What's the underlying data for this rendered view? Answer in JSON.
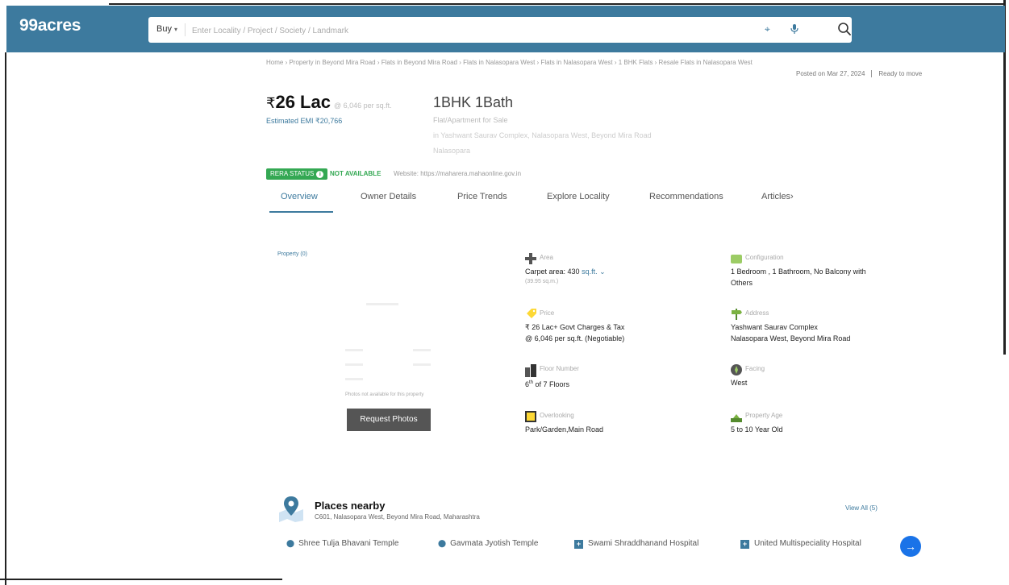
{
  "header": {
    "logo": "99acres",
    "buy_label": "Buy",
    "search_placeholder": "Enter Locality / Project / Society / Landmark"
  },
  "breadcrumb": "Home  ›  Property in Beyond Mira Road  ›  Flats in Beyond Mira Road  ›  Flats in Nalasopara West  ›  Flats in Nalasopara West  ›  1 BHK Flats  ›  Resale Flats in Nalasopara West",
  "posted": {
    "date": "Posted on Mar 27, 2024",
    "status": "Ready to move"
  },
  "listing": {
    "price_symbol": "₹",
    "price": "26 Lac",
    "price_sub": "@ 6,046 per sq.ft.",
    "emi": "Estimated EMI ₹20,766",
    "config": "1BHK 1Bath",
    "type_line": "Flat/Apartment for Sale",
    "address_line": "in Yashwant Saurav Complex, Nalasopara West, Beyond Mira Road",
    "extra_line": "Nalasopara"
  },
  "rera": {
    "badge": "RERA STATUS",
    "status": "NOT AVAILABLE",
    "website": "Website: https://maharera.mahaonline.gov.in"
  },
  "tabs": [
    "Overview",
    "Owner Details",
    "Price Trends",
    "Explore Locality",
    "Recommendations",
    "Articles"
  ],
  "photos": {
    "count": "Property (0)",
    "note": "Photos not available for this property",
    "request_button": "Request Photos"
  },
  "details": {
    "area": {
      "label": "Area",
      "value": "Carpet area: 430",
      "unit": "sq.ft.",
      "sub": "(39.95 sq.m.)"
    },
    "configuration": {
      "label": "Configuration",
      "value": "1 Bedroom , 1 Bathroom, No Balcony with",
      "value2": "Others"
    },
    "price": {
      "label": "Price",
      "value": "₹ 26 Lac+ Govt Charges & Tax",
      "value2": "@ 6,046 per sq.ft. (Negotiable)"
    },
    "address": {
      "label": "Address",
      "value": "Yashwant Saurav Complex",
      "value2": "Nalasopara West, Beyond Mira Road"
    },
    "floor": {
      "label": "Floor Number",
      "value_sup": "6",
      "value_sup_suffix": "th",
      "value": " of 7 Floors"
    },
    "facing": {
      "label": "Facing",
      "value": "West"
    },
    "overlooking": {
      "label": "Overlooking",
      "value": "Park/Garden,Main Road"
    },
    "age": {
      "label": "Property Age",
      "value": "5 to 10 Year Old"
    }
  },
  "places": {
    "title": "Places nearby",
    "subtitle": "C601, Nalasopara West, Beyond Mira Road, Maharashtra",
    "view_all": "View All (5)",
    "items": [
      {
        "name": "Shree Tulja Bhavani Temple",
        "kind": "pin"
      },
      {
        "name": "Gavmata Jyotish Temple",
        "kind": "pin"
      },
      {
        "name": "Swami Shraddhanand Hospital",
        "kind": "hospital"
      },
      {
        "name": "United Multispeciality Hospital",
        "kind": "hospital"
      }
    ]
  },
  "icons": {
    "location": "crosshair-icon",
    "mic": "mic-icon",
    "search": "magnifier-icon",
    "next": "arrow-right-icon"
  },
  "colors": {
    "brand": "#3d7a9e",
    "rera_green": "#34a853",
    "next_button": "#1a73e8"
  }
}
